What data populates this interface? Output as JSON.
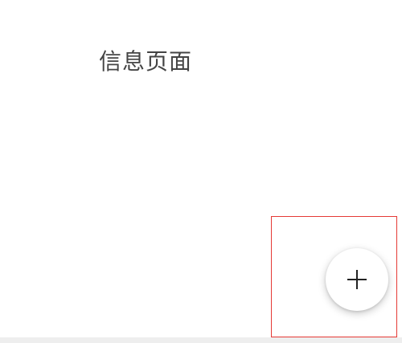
{
  "page": {
    "title": "信息页面"
  },
  "fab": {
    "icon": "plus-icon",
    "icon_color": "#222222"
  },
  "annotation": {
    "highlight_color": "#e53935"
  }
}
